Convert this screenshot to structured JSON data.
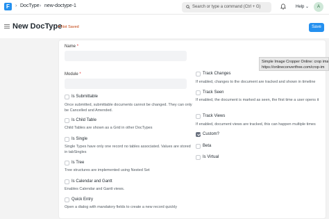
{
  "navbar": {
    "logo": "F",
    "breadcrumbs": [
      "DocType",
      "new-doctype-1"
    ],
    "search_placeholder": "Search or type a command (Ctrl + G)",
    "help_label": "Help",
    "avatar_initial": "A"
  },
  "page": {
    "title": "New DocType",
    "status": "Not Saved",
    "save_label": "Save"
  },
  "form": {
    "name_label": "Name",
    "module_label": "Module",
    "required_mark": "*",
    "left_options": [
      {
        "label": "Is Submittable",
        "checked": false,
        "description": "Once submitted, submittable documents cannot be changed. They can only be Cancelled and Amended."
      },
      {
        "label": "Is Child Table",
        "checked": false,
        "description": "Child Tables are shown as a Grid in other DocTypes"
      },
      {
        "label": "Is Single",
        "checked": false,
        "description": "Single Types have only one record no tables associated. Values are stored in tabSingles"
      },
      {
        "label": "Is Tree",
        "checked": false,
        "description": "Tree structures are implemented using Nested Set"
      },
      {
        "label": "Is Calendar and Gantt",
        "checked": false,
        "description": "Enables Calendar and Gantt views."
      },
      {
        "label": "Quick Entry",
        "checked": false,
        "description": "Open a dialog with mandatory fields to create a new record quickly"
      }
    ],
    "right_options": [
      {
        "label": "Track Changes",
        "checked": false,
        "description": "If enabled, changes to the document are tracked and shown in timeline"
      },
      {
        "label": "Track Seen",
        "checked": false,
        "description": "If enabled, the document is marked as seen, the first time a user opens it"
      },
      {
        "label": "Track Views",
        "checked": false,
        "description": "If enabled, document views are tracked, this can happen multiple times"
      },
      {
        "label": "Custom?",
        "checked": true,
        "description": ""
      },
      {
        "label": "Beta",
        "checked": false,
        "description": ""
      },
      {
        "label": "Is Virtual",
        "checked": false,
        "description": ""
      }
    ]
  },
  "tooltip": {
    "line1": "Simple Image Cropper Online: crop ima",
    "line2": "https://onlineconvertfree.com/crop-im"
  },
  "colors": {
    "primary": "#2490ef",
    "status": "#c2410c",
    "required": "#e03131"
  }
}
